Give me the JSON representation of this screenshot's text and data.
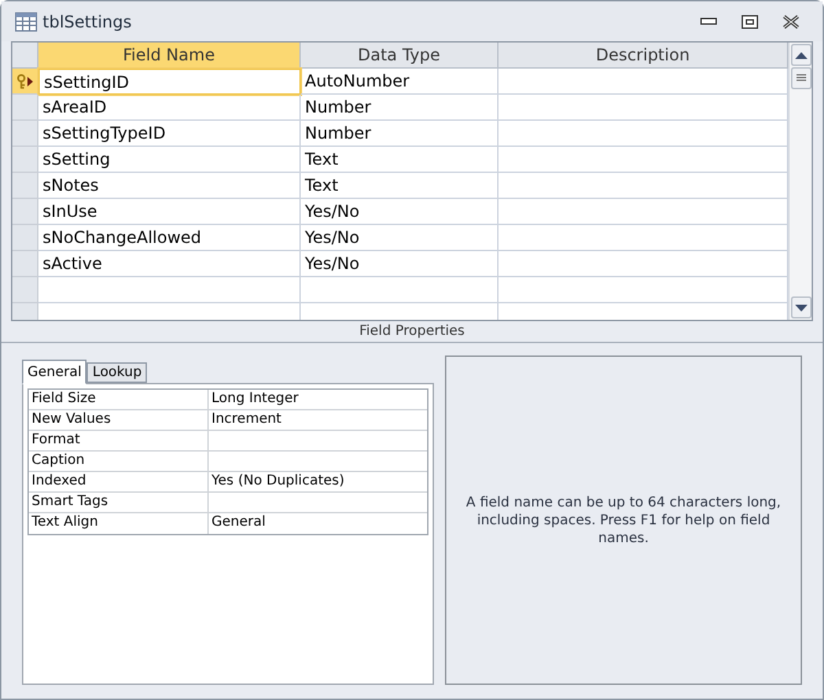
{
  "window": {
    "title": "tblSettings"
  },
  "grid": {
    "columns": [
      {
        "label": "Field Name",
        "selected": true
      },
      {
        "label": "Data Type",
        "selected": false
      },
      {
        "label": "Description",
        "selected": false
      }
    ],
    "rows": [
      {
        "field_name": "sSettingID",
        "data_type": "AutoNumber",
        "primary_key": true,
        "selected": true
      },
      {
        "field_name": "sAreaID",
        "data_type": "Number",
        "primary_key": false,
        "selected": false
      },
      {
        "field_name": "sSettingTypeID",
        "data_type": "Number",
        "primary_key": false,
        "selected": false
      },
      {
        "field_name": "sSetting",
        "data_type": "Text",
        "primary_key": false,
        "selected": false
      },
      {
        "field_name": "sNotes",
        "data_type": "Text",
        "primary_key": false,
        "selected": false
      },
      {
        "field_name": "sInUse",
        "data_type": "Yes/No",
        "primary_key": false,
        "selected": false
      },
      {
        "field_name": "sNoChangeAllowed",
        "data_type": "Yes/No",
        "primary_key": false,
        "selected": false
      },
      {
        "field_name": "sActive",
        "data_type": "Yes/No",
        "primary_key": false,
        "selected": false
      }
    ]
  },
  "field_properties": {
    "title": "Field Properties",
    "tabs": [
      {
        "label": "General",
        "selected": true
      },
      {
        "label": "Lookup",
        "selected": false
      }
    ],
    "properties": [
      {
        "name": "Field Size",
        "value": "Long Integer"
      },
      {
        "name": "New Values",
        "value": "Increment"
      },
      {
        "name": "Format"
      },
      {
        "name": "Caption"
      },
      {
        "name": "Indexed",
        "value": "Yes (No Duplicates)"
      },
      {
        "name": "Smart Tags"
      },
      {
        "name": "Text Align",
        "value": "General"
      }
    ],
    "help": "A field name can be up to 64 characters long, including spaces. Press F1 for help on field names."
  }
}
